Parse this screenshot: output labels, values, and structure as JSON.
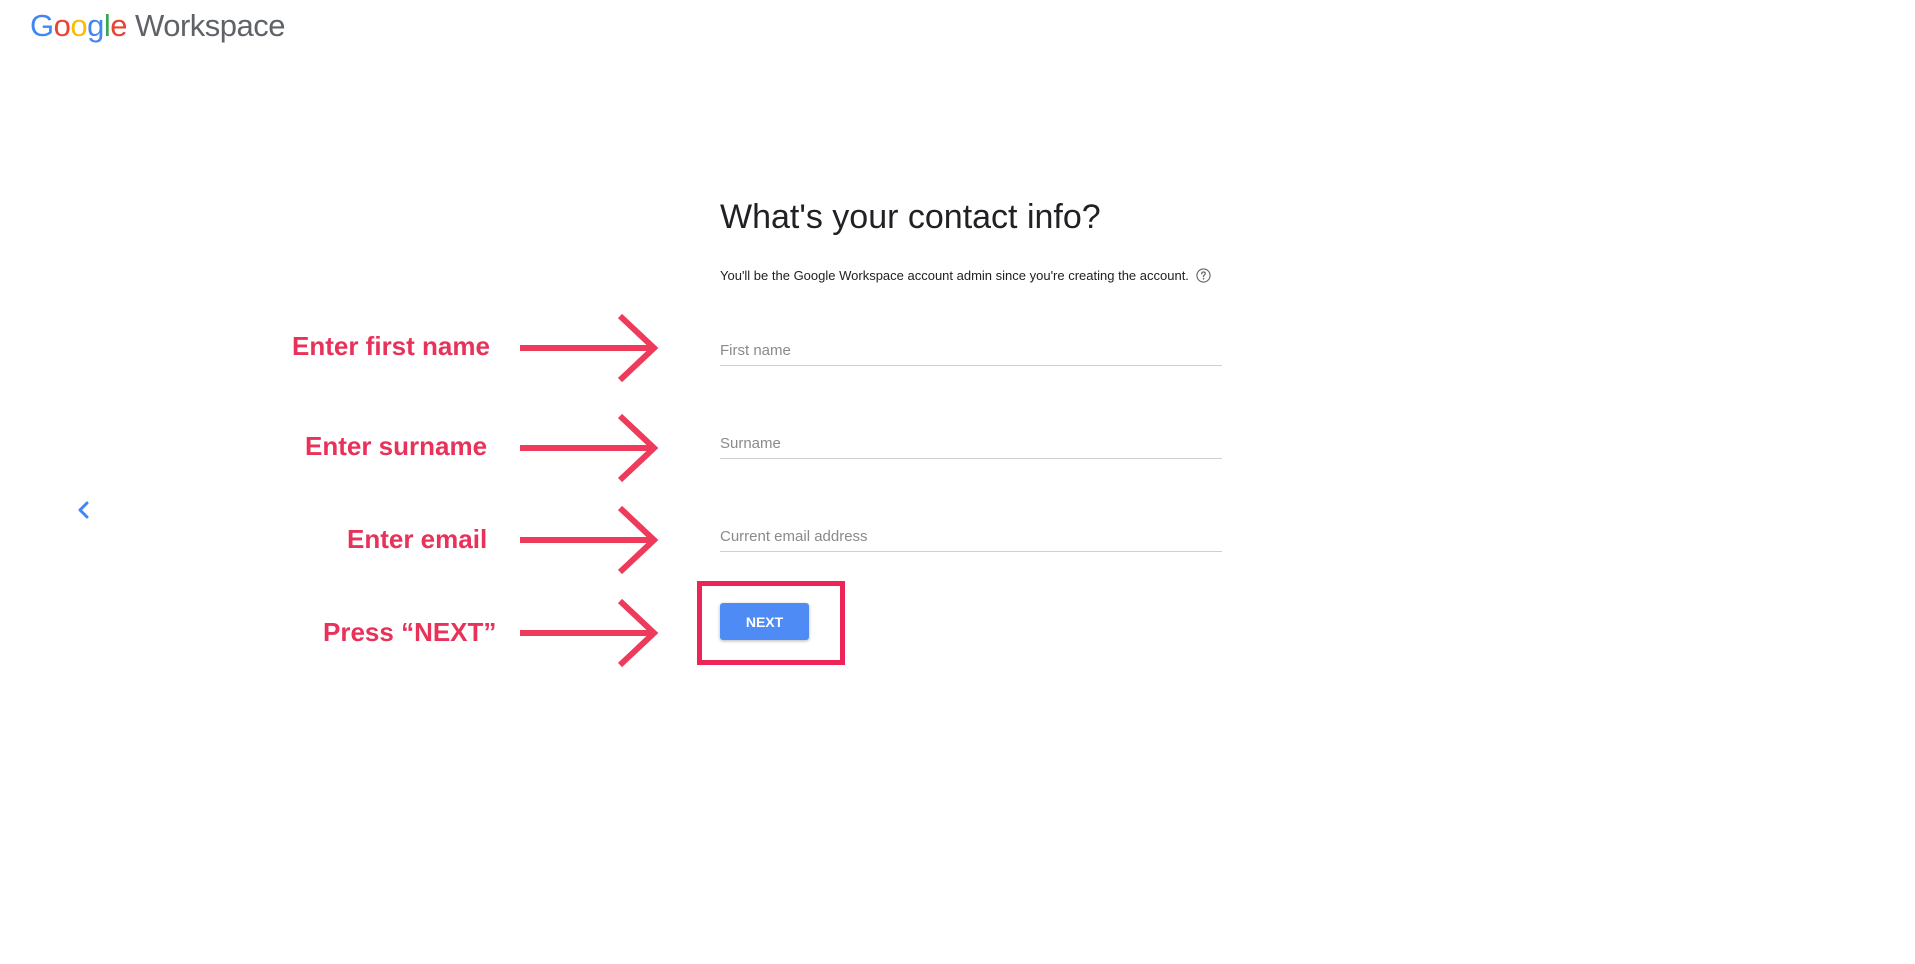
{
  "header": {
    "logo_letters": [
      "G",
      "o",
      "o",
      "g",
      "l",
      "e"
    ],
    "product_name": "Workspace"
  },
  "form": {
    "title": "What's your contact info?",
    "subtitle": "You'll be the Google Workspace account admin since you're creating the account.",
    "first_name_placeholder": "First name",
    "surname_placeholder": "Surname",
    "email_placeholder": "Current email address",
    "next_label": "NEXT"
  },
  "annotations": {
    "first_name": "Enter first name",
    "surname": "Enter surname",
    "email": "Enter email",
    "next": "Press “NEXT”"
  },
  "colors": {
    "annotation": "#e8325a",
    "highlight_box": "#ec2457",
    "button": "#4f8bf5",
    "back_chevron": "#4285F4"
  },
  "icons": {
    "back": "chevron-left-icon",
    "help": "question-circle-icon",
    "annotation_arrow": "arrow-right-icon"
  }
}
